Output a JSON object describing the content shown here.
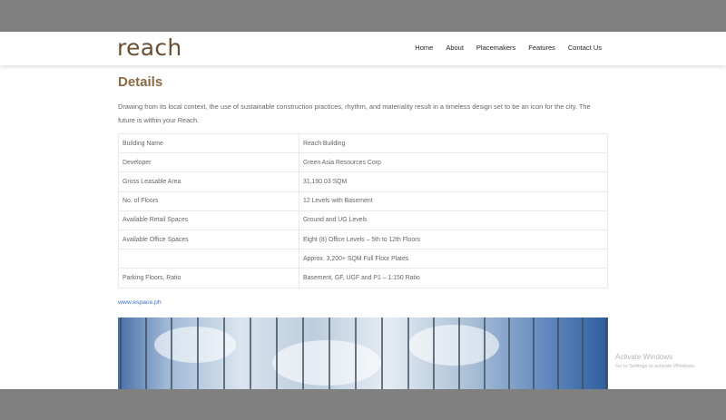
{
  "header": {
    "logo": "reach",
    "nav": [
      "Home",
      "About",
      "Placemakers",
      "Features",
      "Contact Us"
    ]
  },
  "main": {
    "title": "Details",
    "intro": "Drawing from its local context, the use of sustainable construction practices, rhythm, and materiality result in a timeless design set to be an icon for the city. The future is within your Reach.",
    "table": [
      {
        "label": "Building Name",
        "value": "Reach Building"
      },
      {
        "label": "Developer",
        "value": "Green Asia Resources Corp"
      },
      {
        "label": "Gross Leasable Area",
        "value": "31,190.03 SQM"
      },
      {
        "label": "No. of Floors",
        "value": "12 Levels with Basement"
      },
      {
        "label": "Available Retail Spaces",
        "value": "Ground and UG Levels"
      },
      {
        "label": "Available Office Spaces",
        "value": "Eight (8) Office Levels – 5th to 12th Floors"
      },
      {
        "label": "",
        "value": "Approx. 3,200+ SQM Full Floor Plates"
      },
      {
        "label": "Parking Floors, Ratio",
        "value": "Basement, GF, UGF and P1 – 1:150 Ratio"
      }
    ],
    "link": "www.espace.ph"
  },
  "watermark": {
    "line1": "Activate Windows",
    "line2": "Go to Settings to activate Windows."
  },
  "colors": {
    "brand": "#8b6a47",
    "logo": "#6b4f35",
    "link": "#3b6bc4",
    "chrome_gray": "#808080"
  }
}
